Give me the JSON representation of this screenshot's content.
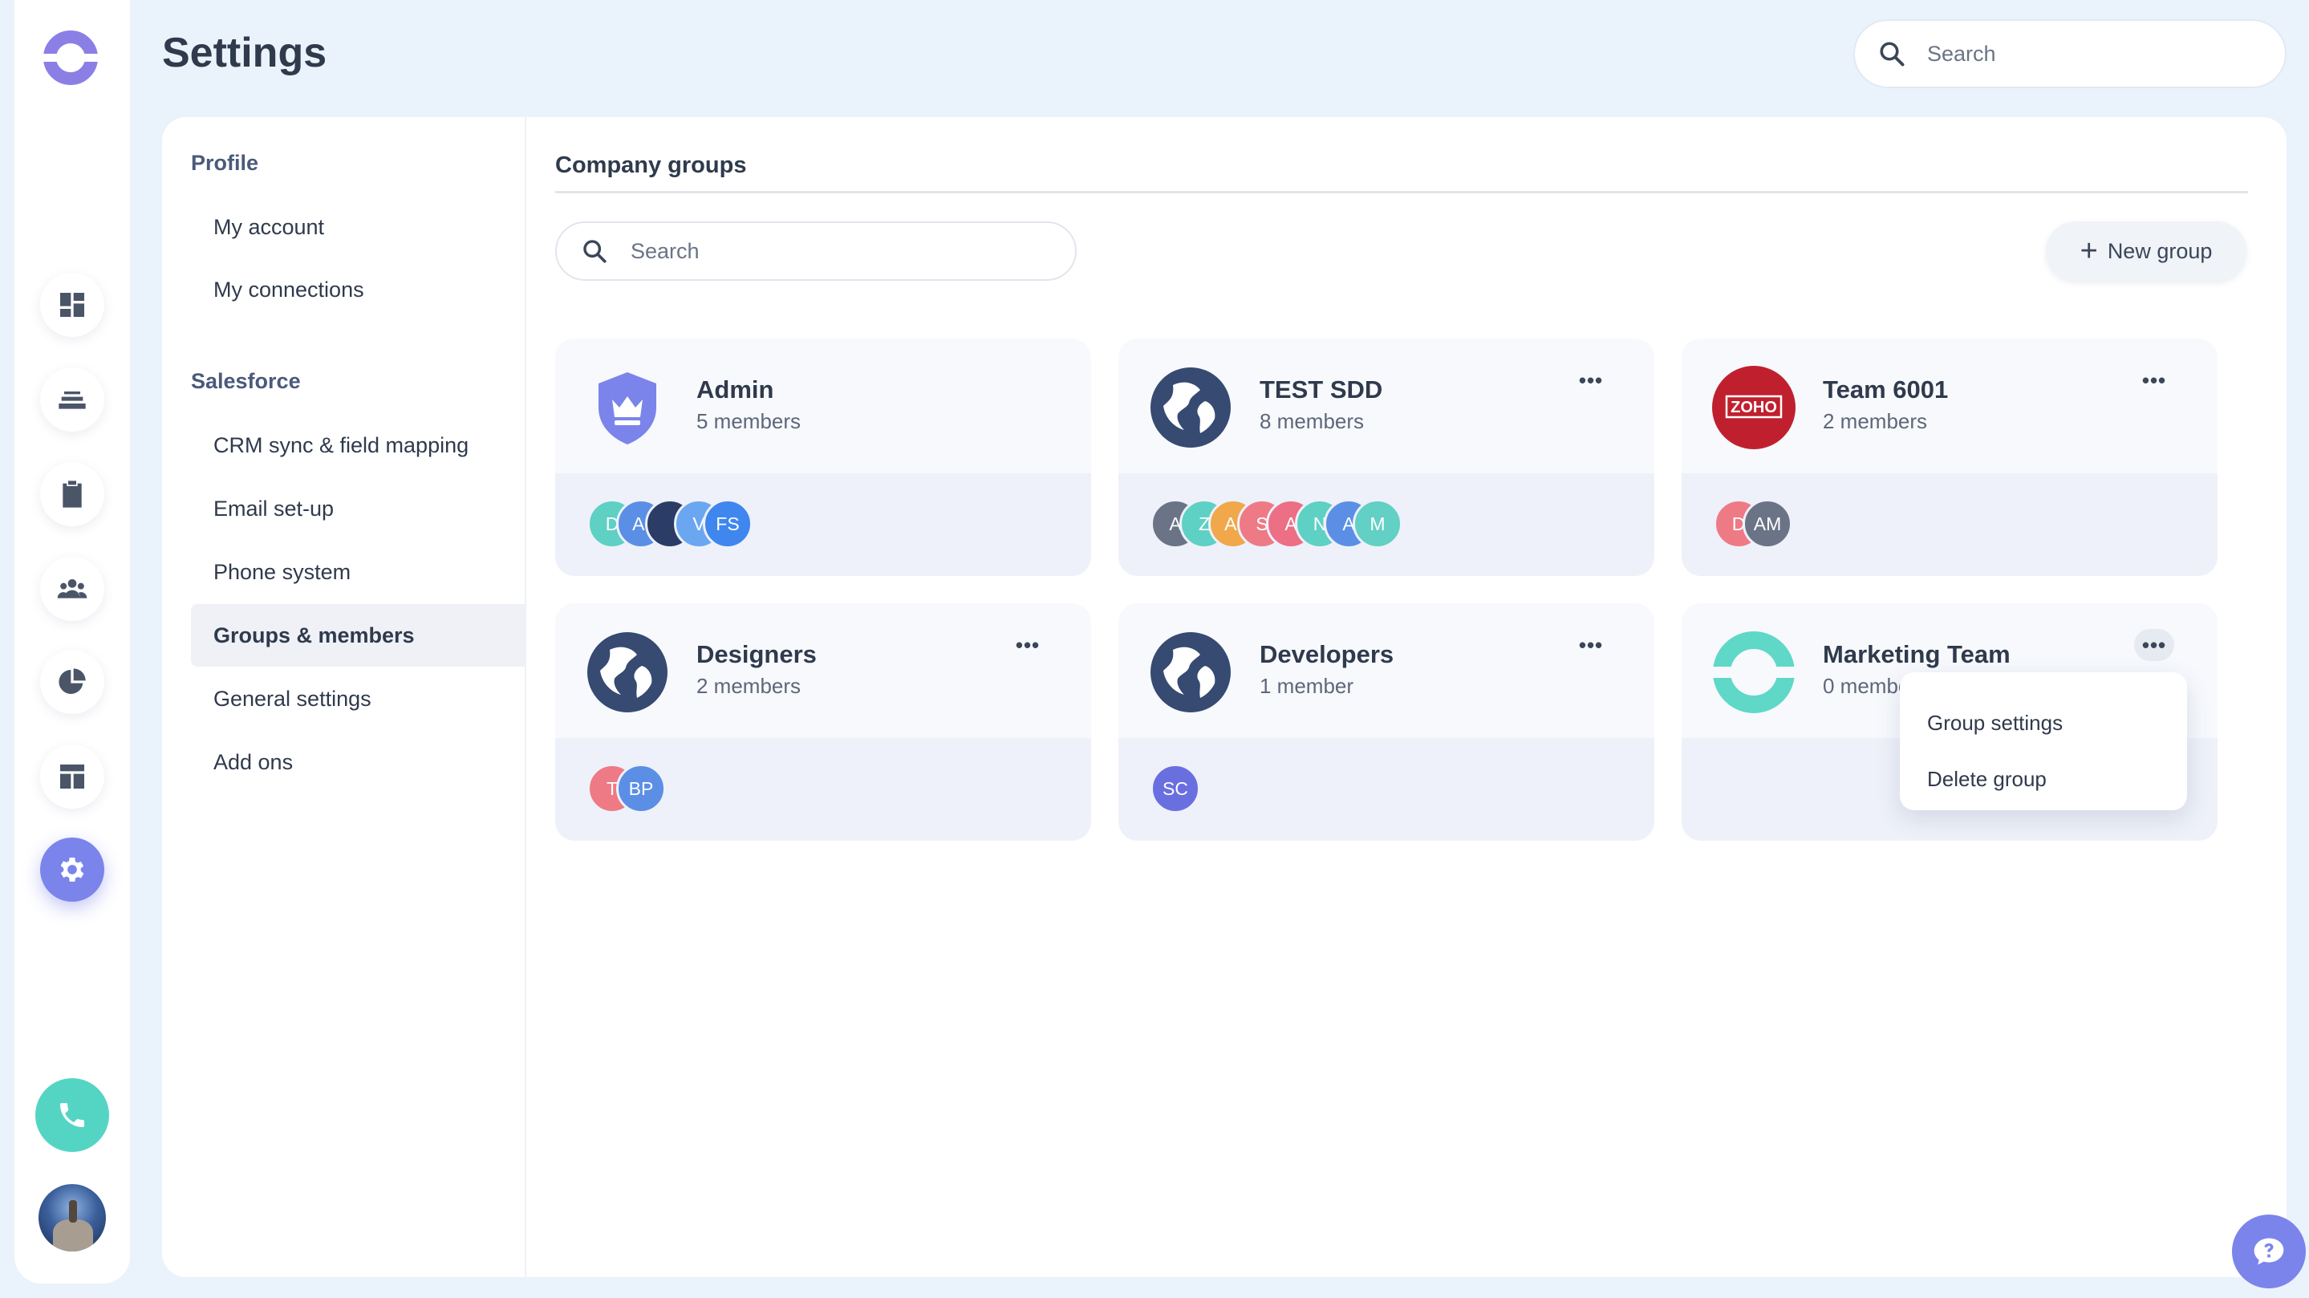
{
  "header": {
    "title": "Settings",
    "search_placeholder": "Search"
  },
  "rail": {
    "items": [
      {
        "name": "dashboard",
        "icon": "dashboard-icon"
      },
      {
        "name": "stack",
        "icon": "stack-icon"
      },
      {
        "name": "tasks",
        "icon": "clipboard-icon"
      },
      {
        "name": "contacts",
        "icon": "people-icon"
      },
      {
        "name": "reports",
        "icon": "pie-chart-icon"
      },
      {
        "name": "layout",
        "icon": "layout-icon"
      },
      {
        "name": "settings",
        "icon": "gear-icon",
        "active": true
      }
    ],
    "call_icon": "phone-icon",
    "user_avatar": "user-avatar"
  },
  "subnav": {
    "profile_heading": "Profile",
    "profile_items": [
      "My account",
      "My connections"
    ],
    "salesforce_heading": "Salesforce",
    "salesforce_items": [
      "CRM sync & field mapping",
      "Email set-up",
      "Phone system",
      "Groups & members",
      "General settings",
      "Add ons"
    ],
    "active_item": "Groups & members"
  },
  "main": {
    "section_title": "Company groups",
    "search_placeholder": "Search",
    "new_group_label": "New group"
  },
  "groups": [
    {
      "name": "Admin",
      "count": "5 members",
      "icon": "shield-crown-icon",
      "avatars": [
        {
          "t": "D",
          "c": "#5fd0c4"
        },
        {
          "t": "AI",
          "c": "#5b8fe6"
        },
        {
          "t": "",
          "c": "#2b3d66"
        },
        {
          "t": "V",
          "c": "#6aa7f0"
        },
        {
          "t": "FS",
          "c": "#3f86ef"
        }
      ]
    },
    {
      "name": "TEST SDD",
      "count": "8 members",
      "icon": "globe-icon",
      "avatars": [
        {
          "t": "A",
          "c": "#6b7486"
        },
        {
          "t": "Z",
          "c": "#5fd0c4"
        },
        {
          "t": "AI",
          "c": "#f0a84a"
        },
        {
          "t": "S",
          "c": "#ee7a86"
        },
        {
          "t": "A",
          "c": "#ec6f86"
        },
        {
          "t": "N",
          "c": "#5fd0c4"
        },
        {
          "t": "A",
          "c": "#5b8fe6"
        },
        {
          "t": "M",
          "c": "#62d0c4"
        }
      ]
    },
    {
      "name": "Team 6001",
      "count": "2 members",
      "icon": "zoho-logo",
      "avatars": [
        {
          "t": "D",
          "c": "#ee7a86"
        },
        {
          "t": "AM",
          "c": "#6b7486"
        }
      ]
    },
    {
      "name": "Designers",
      "count": "2 members",
      "icon": "globe-icon",
      "avatars": [
        {
          "t": "T",
          "c": "#ee7a86"
        },
        {
          "t": "BP",
          "c": "#5b8fe6"
        }
      ]
    },
    {
      "name": "Developers",
      "count": "1 member",
      "icon": "globe-icon",
      "avatars": [
        {
          "t": "SC",
          "c": "#6a6fe0"
        }
      ]
    },
    {
      "name": "Marketing Team",
      "count": "0 members",
      "icon": "ring-logo-icon",
      "avatars": []
    }
  ],
  "logo_text": {
    "zoho": "ZOHO"
  },
  "dropdown": {
    "items": [
      "Group settings",
      "Delete group"
    ]
  },
  "colors": {
    "accent": "#7b84ea",
    "teal": "#54d5c4",
    "background": "#eaf3fb",
    "text": "#2f3a4c"
  },
  "help_icon": "chat-help-icon"
}
